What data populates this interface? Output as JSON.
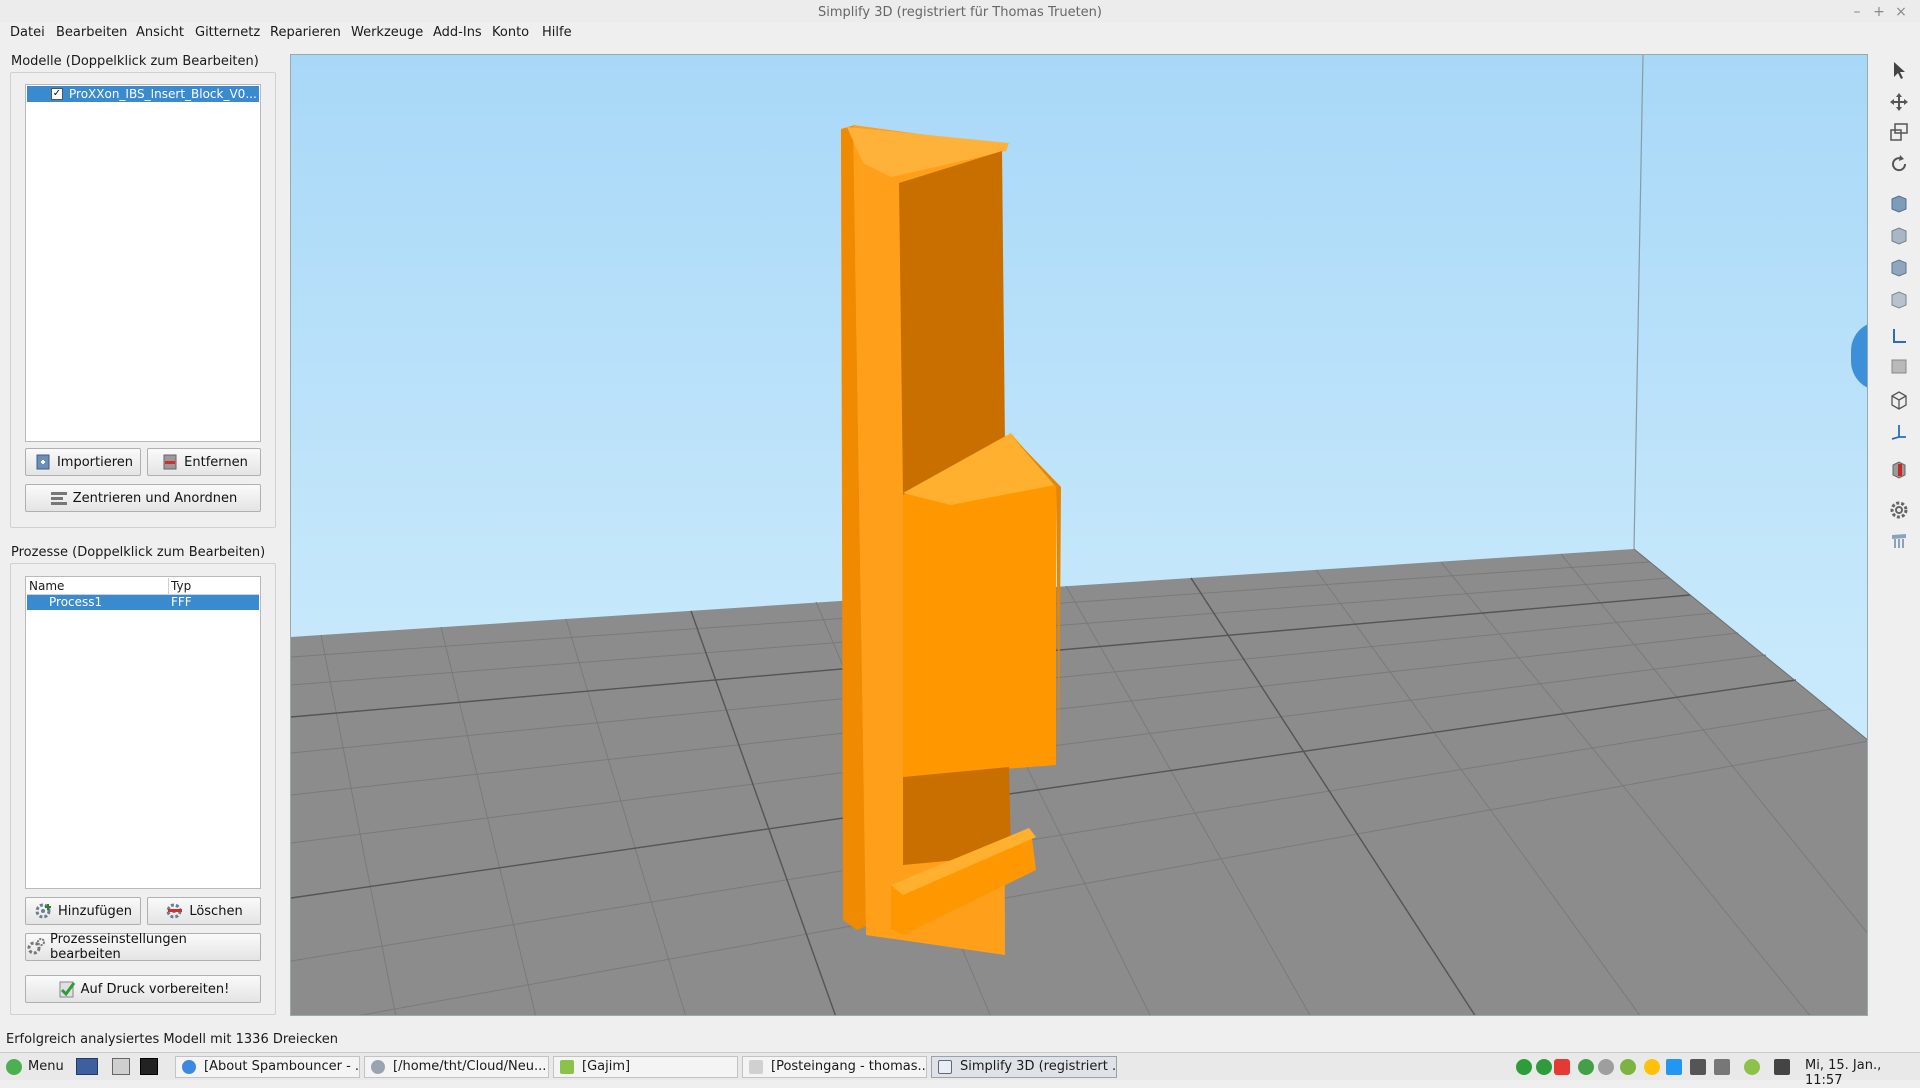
{
  "window": {
    "title": "Simplify 3D (registriert für Thomas Trueten)",
    "controls": [
      "–",
      "+",
      "×"
    ]
  },
  "menu": [
    "Datei",
    "Bearbeiten",
    "Ansicht",
    "Gitternetz",
    "Reparieren",
    "Werkzeuge",
    "Add-Ins",
    "Konto",
    "Hilfe"
  ],
  "models": {
    "label": "Modelle (Doppelklick zum Bearbeiten)",
    "items": [
      {
        "name": "ProXXon_IBS_Insert_Block_V0...",
        "checked": true
      }
    ],
    "import_label": "Importieren",
    "remove_label": "Entfernen",
    "center_label": "Zentrieren und Anordnen"
  },
  "processes": {
    "label": "Prozesse (Doppelklick zum Bearbeiten)",
    "columns": [
      "Name",
      "Typ"
    ],
    "rows": [
      {
        "name": "Process1",
        "type": "FFF"
      }
    ],
    "add_label": "Hinzufügen",
    "delete_label": "Löschen",
    "edit_label": "Prozesseinstellungen bearbeiten",
    "prepare_label": "Auf Druck vorbereiten!"
  },
  "status": "Erfolgreich analysiertes Modell mit 1336 Dreiecken",
  "taskbar": {
    "menu_label": "Menu",
    "tasks": [
      "[About Spambouncer - ...",
      "[/home/tht/Cloud/Neu...",
      "[Gajim]",
      "[Posteingang - thomas....",
      "Simplify 3D (registriert ..."
    ],
    "clock": "Mi, 15. Jan., 11:57"
  },
  "colors": {
    "model": "#ff9800",
    "selection": "#3a8ad0",
    "sky": "#a8d8f8",
    "bed": "#8c8c8c"
  },
  "toolbar_icons": [
    "select-icon",
    "move-icon",
    "scale-icon",
    "rotate-icon",
    "view-iso-icon",
    "view-front-icon",
    "view-top-icon",
    "view-side-icon",
    "axes-view-icon",
    "solid-view-icon",
    "wireframe-icon",
    "axis-icon",
    "section-icon",
    "settings-icon",
    "support-icon"
  ]
}
